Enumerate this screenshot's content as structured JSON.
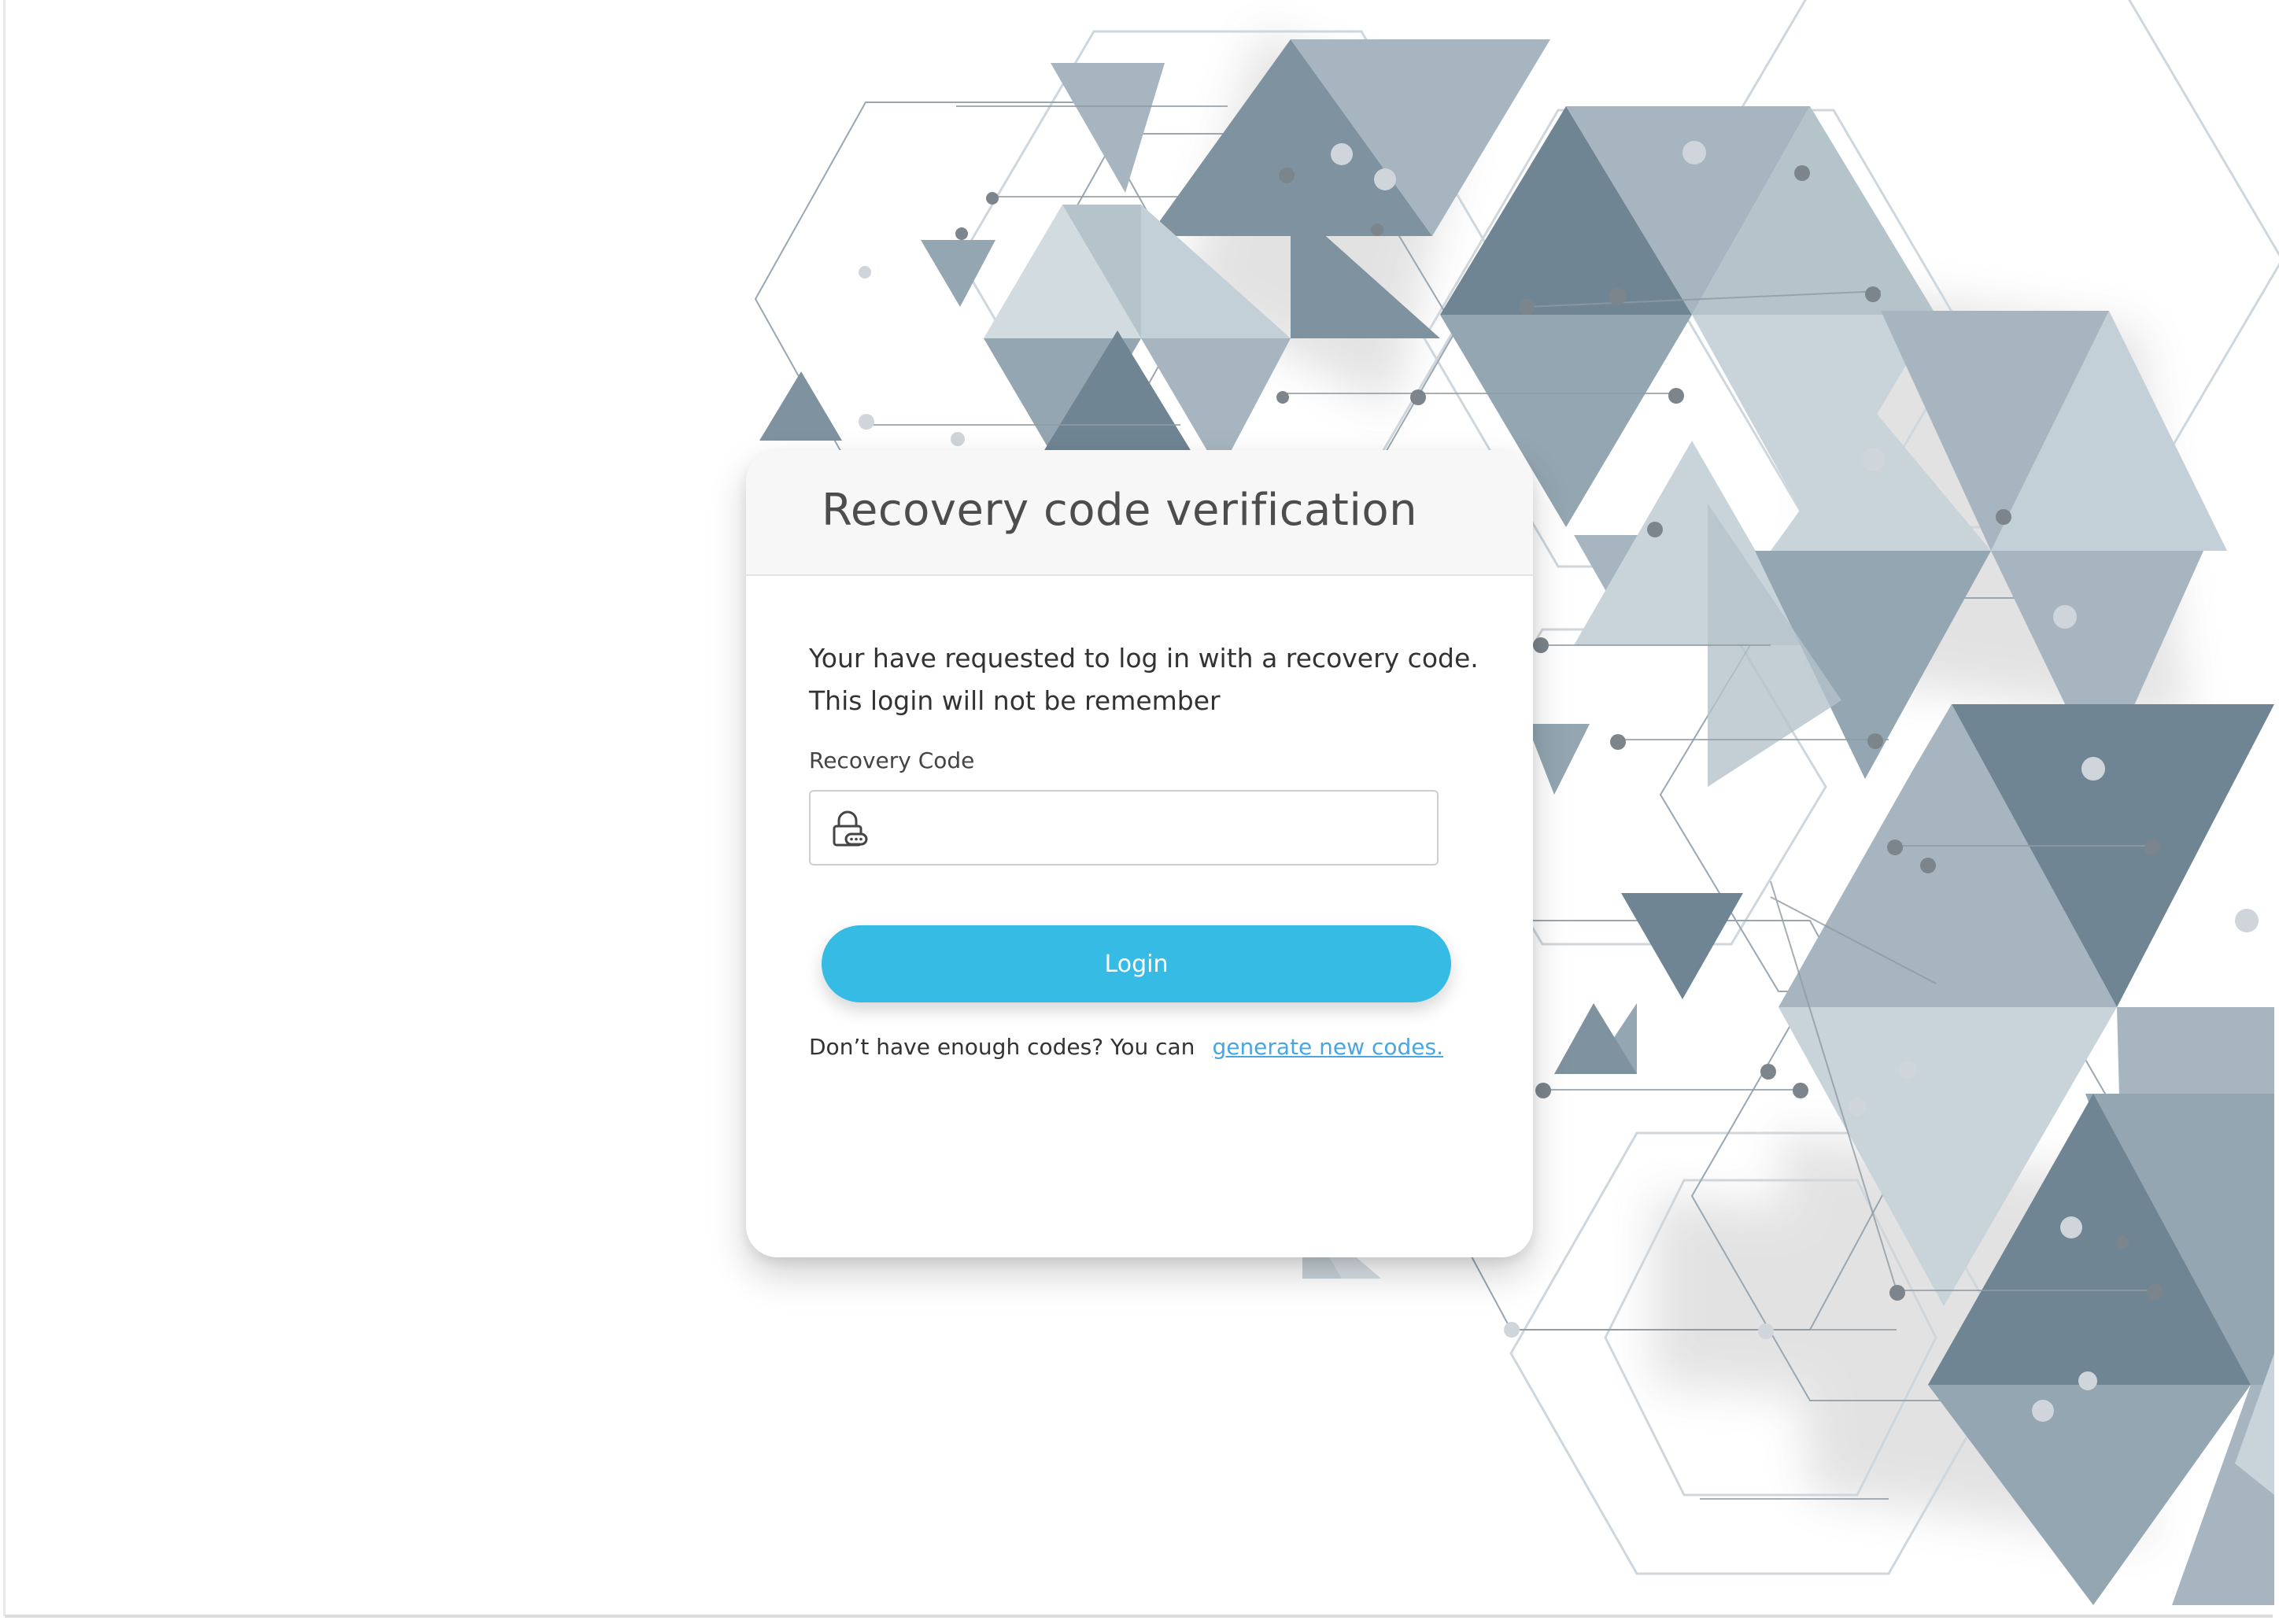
{
  "card": {
    "title": "Recovery code verification",
    "message_line1": "Your have requested to log in with a recovery code.",
    "message_line2": "This login will not be remember",
    "field_label": "Recovery Code",
    "field_value": "",
    "field_placeholder": "",
    "login_label": "Login",
    "footer_text": "Don’t have enough codes? You can",
    "footer_link": "generate new codes."
  },
  "icons": {
    "field_icon": "lock-icon"
  },
  "colors": {
    "accent": "#36bbe4",
    "link": "#4aa6e0",
    "title_text": "#4d4d4d",
    "triangle_dark": "#6f8593",
    "triangle_mid": "#93a6b1",
    "triangle_light": "#c8d3da"
  }
}
